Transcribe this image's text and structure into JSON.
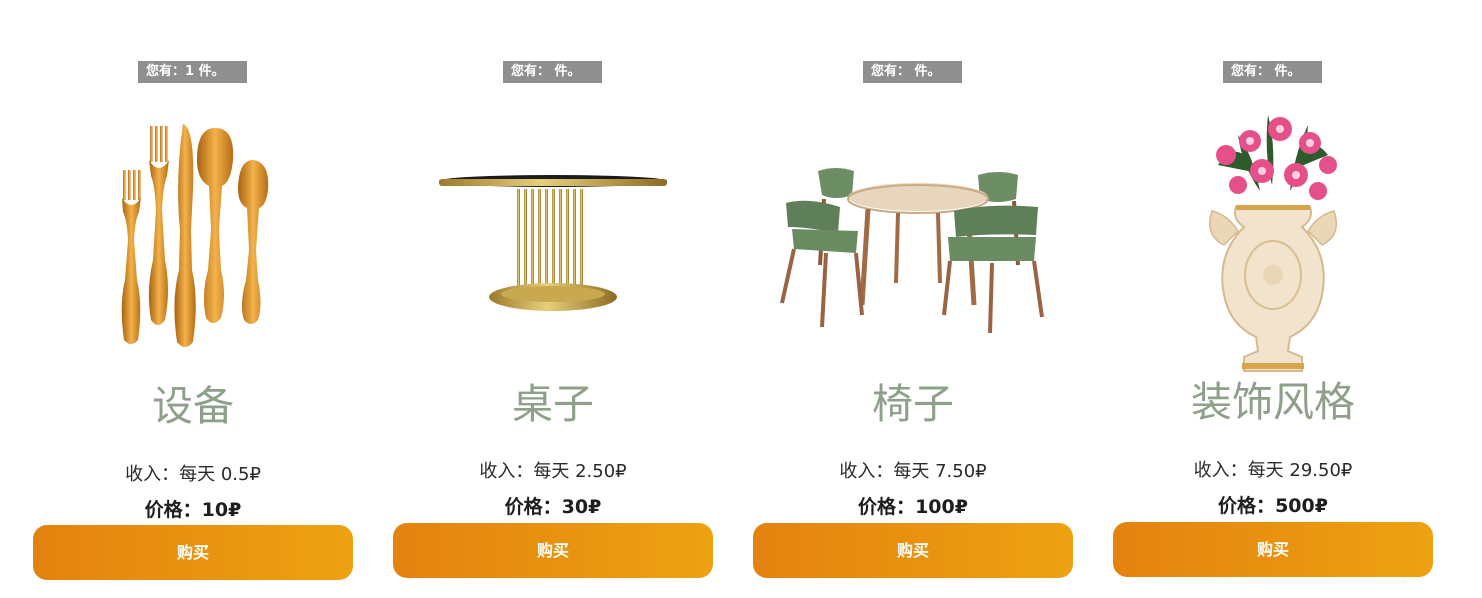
{
  "cards": [
    {
      "badge": {
        "prefix": "您有：",
        "count": "1",
        "suffix": " 件。"
      },
      "title": "设备",
      "income_label": "收入：",
      "income_value": "每天 0.5₽",
      "price_label": "价格：",
      "price_value": "10₽",
      "buy_label": "购买",
      "image": "gold-cutlery-set"
    },
    {
      "badge": {
        "prefix": "您有：",
        "count": "",
        "suffix": " 件。"
      },
      "title": "桌子",
      "income_label": "收入：",
      "income_value": "每天 2.50₽",
      "price_label": "价格：",
      "price_value": "30₽",
      "buy_label": "购买",
      "image": "round-gold-table"
    },
    {
      "badge": {
        "prefix": "您有：",
        "count": "",
        "suffix": " 件。"
      },
      "title": "椅子",
      "income_label": "收入：",
      "income_value": "每天 7.50₽",
      "price_label": "价格：",
      "price_value": "100₽",
      "buy_label": "购买",
      "image": "dining-table-with-green-chairs"
    },
    {
      "badge": {
        "prefix": "您有：",
        "count": "",
        "suffix": " 件。"
      },
      "title": "装饰风格",
      "income_label": "收入：",
      "income_value": "每天 29.50₽",
      "price_label": "价格：",
      "price_value": "500₽",
      "buy_label": "购买",
      "image": "ornate-vase-with-lilies"
    }
  ],
  "colors": {
    "badge_bg": "#8f8f8f",
    "title": "#8ea08a",
    "button_start": "#e4820f",
    "button_end": "#eda211"
  }
}
